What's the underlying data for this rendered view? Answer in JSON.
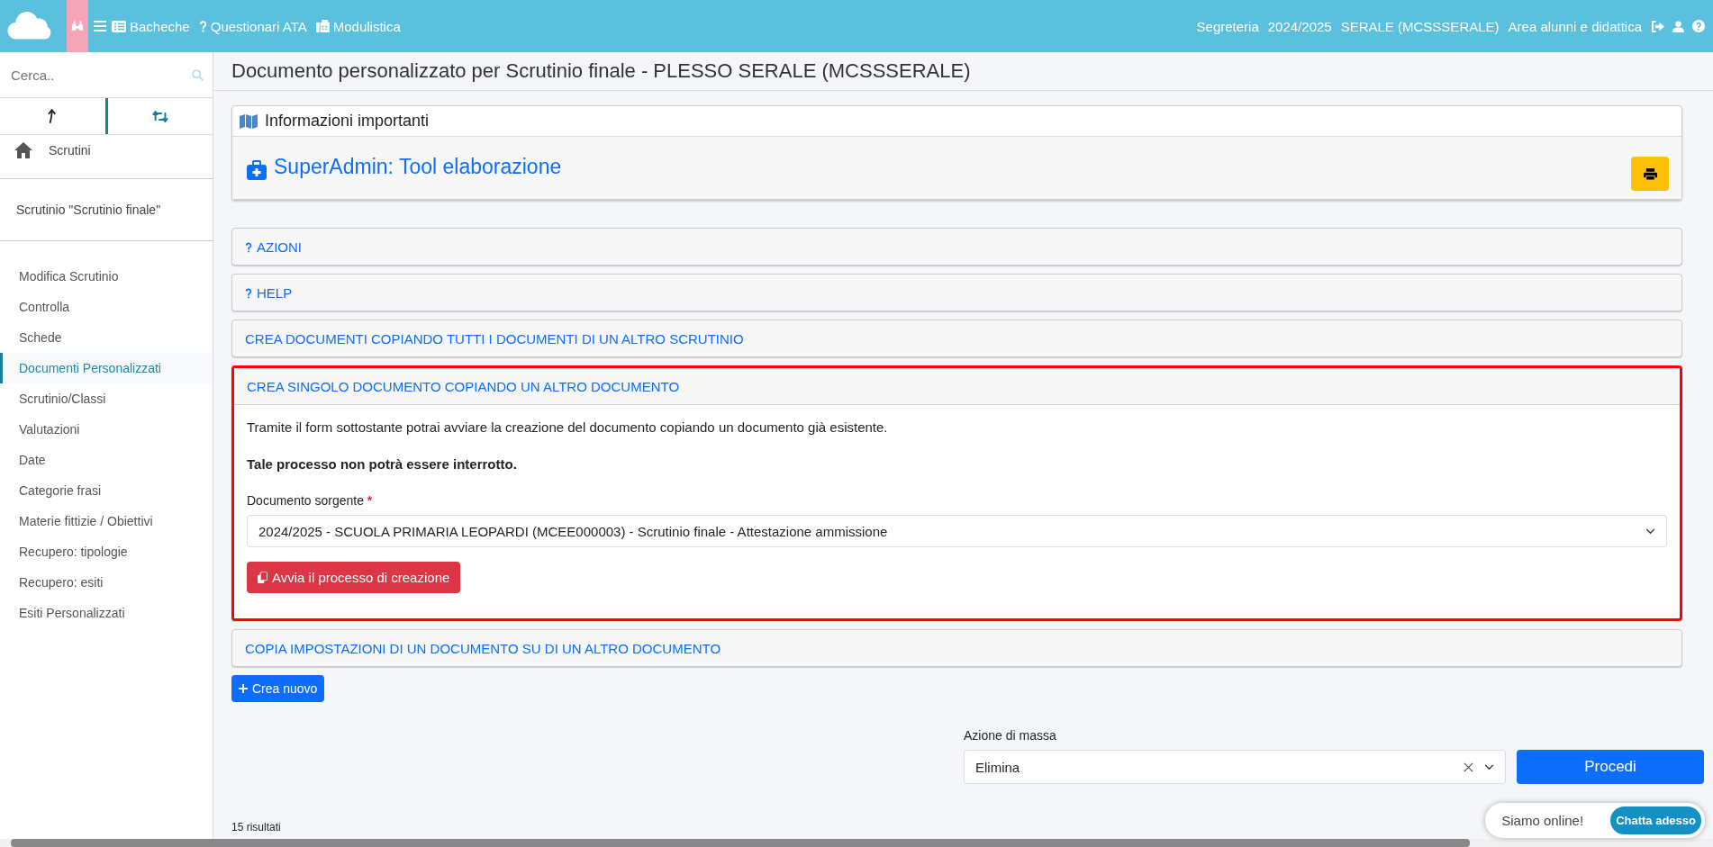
{
  "top_nav": {
    "links": [
      {
        "kind": "list",
        "label": "Bacheche"
      },
      {
        "kind": "question",
        "label": "Questionari ATA"
      },
      {
        "kind": "fax",
        "label": "Modulistica"
      }
    ],
    "context": [
      "Segreteria",
      "2024/2025",
      "SERALE (MCSSSERALE)",
      "Area alunni e didattica"
    ]
  },
  "sidebar": {
    "search": {
      "placeholder": "Cerca.."
    },
    "tabs": [
      {
        "kind": "up",
        "selected": false
      },
      {
        "kind": "swap",
        "selected": true
      }
    ],
    "home": "Scrutini",
    "context": "Scrutinio \"Scrutinio finale\"",
    "items": [
      {
        "label": "Modifica Scrutinio",
        "selected": false
      },
      {
        "label": "Controlla",
        "selected": false
      },
      {
        "label": "Schede",
        "selected": false
      },
      {
        "label": "Documenti Personalizzati",
        "selected": true
      },
      {
        "label": "Scrutinio/Classi",
        "selected": false
      },
      {
        "label": "Valutazioni",
        "selected": false
      },
      {
        "label": "Date",
        "selected": false
      },
      {
        "label": "Categorie frasi",
        "selected": false
      },
      {
        "label": "Materie fittizie / Obiettivi",
        "selected": false
      },
      {
        "label": "Recupero: tipologie",
        "selected": false
      },
      {
        "label": "Recupero: esiti",
        "selected": false
      },
      {
        "label": "Esiti Personalizzati",
        "selected": false
      }
    ]
  },
  "page_title": "Documento personalizzato per Scrutinio finale - PLESSO SERALE (MCSSSERALE)",
  "info_card": {
    "title": "Informazioni importanti",
    "tool_title": "SuperAdmin: Tool elaborazione"
  },
  "sections": [
    {
      "kind": "help",
      "title": "AZIONI",
      "expanded": false
    },
    {
      "kind": "help",
      "title": "HELP",
      "expanded": false
    },
    {
      "kind": "plain",
      "title": "CREA DOCUMENTI COPIANDO TUTTI I DOCUMENTI DI UN ALTRO SCRUTINIO",
      "expanded": false
    },
    {
      "kind": "plain",
      "title": "CREA SINGOLO DOCUMENTO COPIANDO UN ALTRO DOCUMENTO",
      "expanded": true,
      "intro": "Tramite il form sottostante potrai avviare la creazione del documento copiando un documento già esistente.",
      "warning": "Tale processo non potrà essere interrotto.",
      "field_label": "Documento sorgente",
      "required_mark": "*",
      "field_value": "2024/2025 - SCUOLA PRIMARIA LEOPARDI (MCEE000003) - Scrutinio finale - Attestazione ammissione",
      "button": "Avvia il processo di creazione"
    },
    {
      "kind": "plain",
      "title": "COPIA IMPOSTAZIONI DI UN DOCUMENTO SU DI UN ALTRO DOCUMENTO",
      "expanded": false
    }
  ],
  "create_button": "Crea nuovo",
  "mass_action": {
    "label": "Azione di massa",
    "value": "Elimina",
    "button": "Procedi"
  },
  "results": "15 risultati",
  "chat": {
    "status": "Siamo online!",
    "button": "Chatta adesso"
  }
}
